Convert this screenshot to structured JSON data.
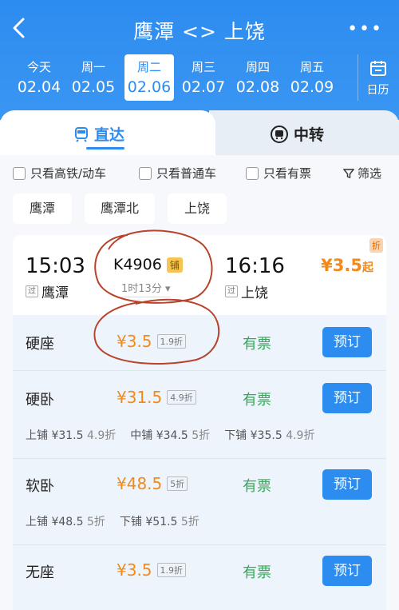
{
  "header": {
    "title": "鹰潭 <> 上饶",
    "back_glyph": "‹",
    "more_glyph": "•••"
  },
  "dates": [
    {
      "weekday": "今天",
      "date": "02.04"
    },
    {
      "weekday": "周一",
      "date": "02.05"
    },
    {
      "weekday": "周二",
      "date": "02.06"
    },
    {
      "weekday": "周三",
      "date": "02.07"
    },
    {
      "weekday": "周四",
      "date": "02.08"
    },
    {
      "weekday": "周五",
      "date": "02.09"
    }
  ],
  "calendar_label": "日历",
  "tabs": {
    "direct": "直达",
    "transfer": "中转"
  },
  "filters": {
    "high_speed": "只看高铁/动车",
    "normal": "只看普通车",
    "available": "只看有票",
    "filter": "筛选"
  },
  "stations": [
    "鹰潭",
    "鹰潭北",
    "上饶"
  ],
  "train": {
    "depart_time": "15:03",
    "depart_station": "鹰潭",
    "depart_tag": "过",
    "number": "K4906",
    "badge": "铺",
    "duration": "1时13分",
    "arrive_time": "16:16",
    "arrive_station": "上饶",
    "arrive_tag": "过",
    "lowest_price": "¥3.5",
    "lowest_suffix": "起",
    "discount_flag": "折"
  },
  "seats": [
    {
      "name": "硬座",
      "price": "¥3.5",
      "discount": "1.9折",
      "status": "有票",
      "action": "预订"
    },
    {
      "name": "硬卧",
      "price": "¥31.5",
      "discount": "4.9折",
      "status": "有票",
      "action": "预订",
      "berths": [
        {
          "name": "上铺",
          "price": "¥31.5",
          "disc": "4.9折"
        },
        {
          "name": "中铺",
          "price": "¥34.5",
          "disc": "5折"
        },
        {
          "name": "下铺",
          "price": "¥35.5",
          "disc": "4.9折"
        }
      ]
    },
    {
      "name": "软卧",
      "price": "¥48.5",
      "discount": "5折",
      "status": "有票",
      "action": "预订",
      "berths": [
        {
          "name": "上铺",
          "price": "¥48.5",
          "disc": "5折"
        },
        {
          "name": "下铺",
          "price": "¥51.5",
          "disc": "5折"
        }
      ]
    },
    {
      "name": "无座",
      "price": "¥3.5",
      "discount": "1.9折",
      "status": "有票",
      "action": "预订"
    }
  ],
  "colors": {
    "brand": "#2d8cf0",
    "price": "#f28a1a",
    "available": "#3aa55a",
    "annotation": "#b8432b"
  }
}
